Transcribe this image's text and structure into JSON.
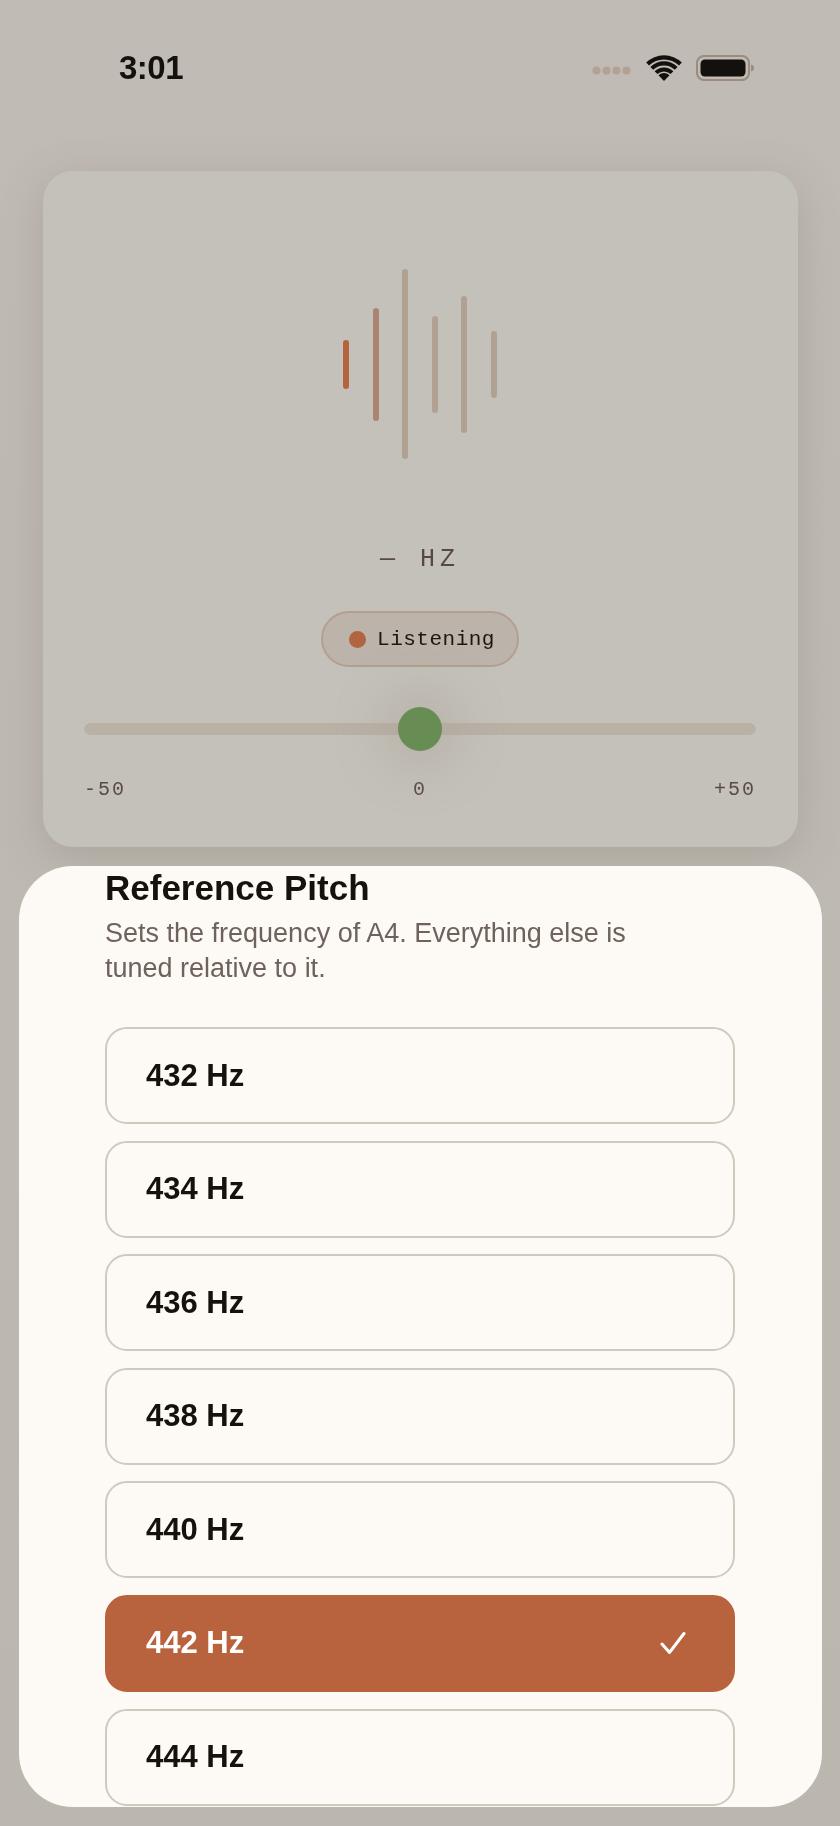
{
  "status_bar": {
    "time": "3:01"
  },
  "tuner": {
    "reading": "— HZ",
    "status": {
      "label": "Listening"
    },
    "cents": {
      "level": 0.5,
      "scale_labels": [
        "-50",
        "0",
        "+50"
      ]
    }
  },
  "sheet": {
    "title": "Reference Pitch",
    "description": "Sets the frequency of A4. Everything else is tuned relative to it.",
    "options": [
      {
        "label": "432 Hz",
        "selected": false
      },
      {
        "label": "434 Hz",
        "selected": false
      },
      {
        "label": "436 Hz",
        "selected": false
      },
      {
        "label": "438 Hz",
        "selected": false
      },
      {
        "label": "440 Hz",
        "selected": false
      },
      {
        "label": "442 Hz",
        "selected": true
      },
      {
        "label": "444 Hz",
        "selected": false
      }
    ]
  }
}
